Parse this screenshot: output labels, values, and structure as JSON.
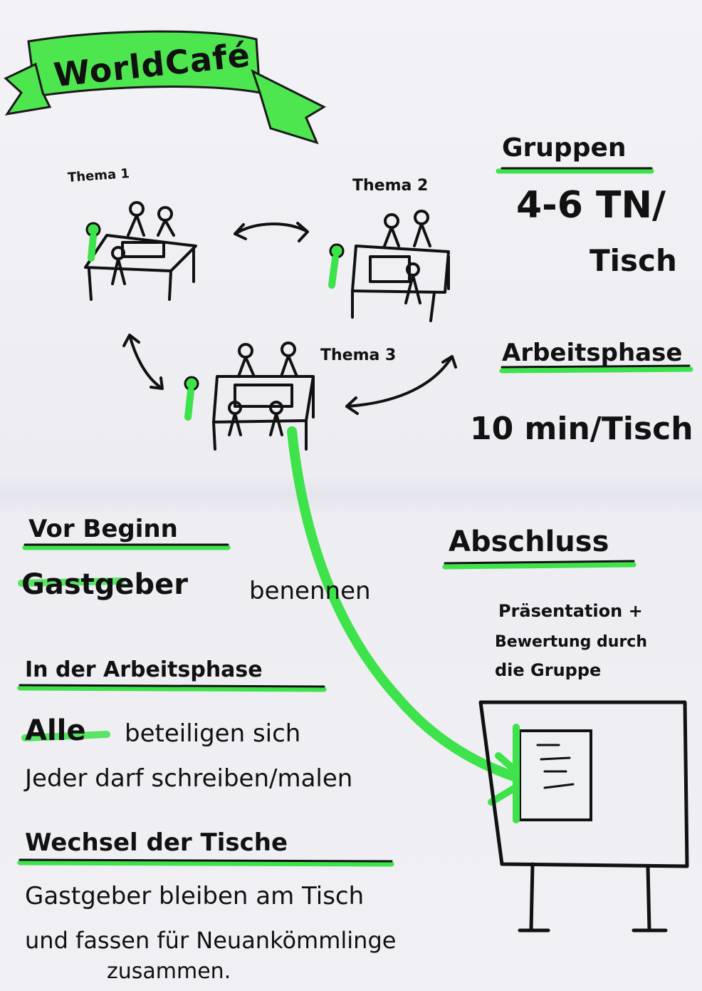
{
  "title": "WorldCafé",
  "tables": [
    {
      "label": "Thema 1"
    },
    {
      "label": "Thema 2"
    },
    {
      "label": "Thema 3"
    }
  ],
  "groups": {
    "heading": "Gruppen",
    "line1": "4-6 TN/",
    "line2": "Tisch"
  },
  "work_phase": {
    "heading": "Arbeitsphase",
    "value": "10 min/Tisch"
  },
  "before_start": {
    "heading": "Vor Beginn",
    "strong": "Gastgeber",
    "text": "benennen"
  },
  "during_phase": {
    "heading": "In der Arbeitsphase",
    "strong": "Alle",
    "line1_rest": "beteiligen sich",
    "line2": "Jeder darf schreiben/malen"
  },
  "change_tables": {
    "heading": "Wechsel der Tische",
    "line1": "Gastgeber bleiben am Tisch",
    "line2": "und fassen für Neuankömmlinge",
    "line3": "zusammen."
  },
  "closing": {
    "heading": "Abschluss",
    "line1": "Präsentation +",
    "line2": "Bewertung durch",
    "line3": "die Gruppe"
  },
  "colors": {
    "accent_green": "#3ee24a",
    "ink": "#111111",
    "paper": "#f1f1f5"
  }
}
